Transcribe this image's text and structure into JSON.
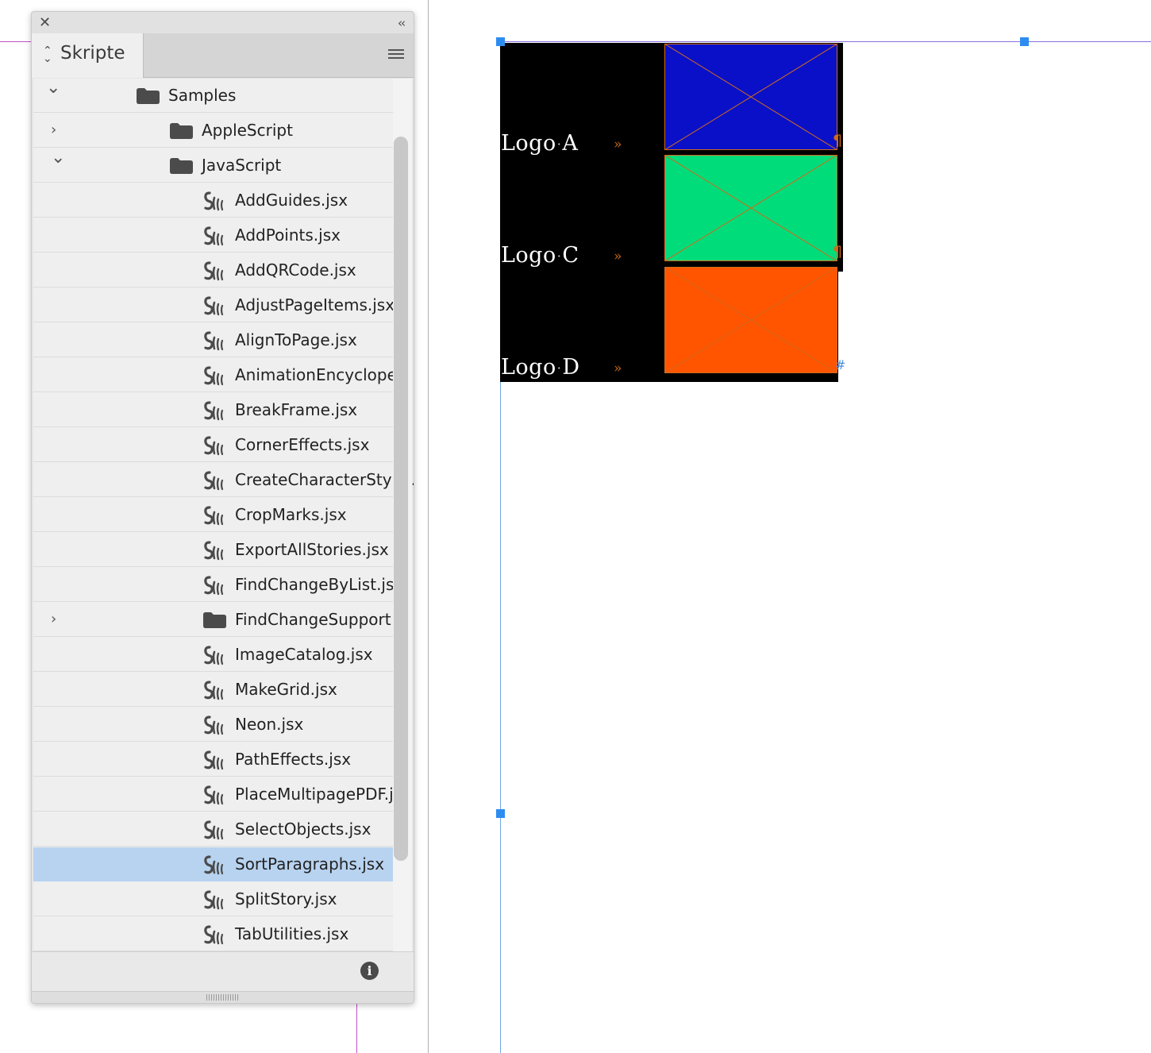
{
  "panel": {
    "title": "Skripte",
    "close_glyph": "✕",
    "collapse_glyph": "‹‹",
    "tree": [
      {
        "label": "Samples",
        "type": "folder",
        "level": 0,
        "expanded": true
      },
      {
        "label": "AppleScript",
        "type": "folder",
        "level": 1,
        "expanded": false
      },
      {
        "label": "JavaScript",
        "type": "folder",
        "level": 1,
        "expanded": true
      },
      {
        "label": "AddGuides.jsx",
        "type": "script",
        "level": 2
      },
      {
        "label": "AddPoints.jsx",
        "type": "script",
        "level": 2
      },
      {
        "label": "AddQRCode.jsx",
        "type": "script",
        "level": 2
      },
      {
        "label": "AdjustPageItems.jsx",
        "type": "script",
        "level": 2
      },
      {
        "label": "AlignToPage.jsx",
        "type": "script",
        "level": 2
      },
      {
        "label": "AnimationEncycloped...",
        "type": "script",
        "level": 2
      },
      {
        "label": "BreakFrame.jsx",
        "type": "script",
        "level": 2
      },
      {
        "label": "CornerEffects.jsx",
        "type": "script",
        "level": 2
      },
      {
        "label": "CreateCharacterStyle....",
        "type": "script",
        "level": 2
      },
      {
        "label": "CropMarks.jsx",
        "type": "script",
        "level": 2
      },
      {
        "label": "ExportAllStories.jsx",
        "type": "script",
        "level": 2
      },
      {
        "label": "FindChangeByList.jsx",
        "type": "script",
        "level": 2
      },
      {
        "label": "FindChangeSupport",
        "type": "folder",
        "level": 2,
        "expanded": false
      },
      {
        "label": "ImageCatalog.jsx",
        "type": "script",
        "level": 2
      },
      {
        "label": "MakeGrid.jsx",
        "type": "script",
        "level": 2
      },
      {
        "label": "Neon.jsx",
        "type": "script",
        "level": 2
      },
      {
        "label": "PathEffects.jsx",
        "type": "script",
        "level": 2
      },
      {
        "label": "PlaceMultipagePDF.jsx",
        "type": "script",
        "level": 2
      },
      {
        "label": "SelectObjects.jsx",
        "type": "script",
        "level": 2
      },
      {
        "label": "SortParagraphs.jsx",
        "type": "script",
        "level": 2,
        "selected": true
      },
      {
        "label": "SplitStory.jsx",
        "type": "script",
        "level": 2
      },
      {
        "label": "TabUtilities.jsx",
        "type": "script",
        "level": 2
      }
    ],
    "info_glyph": "i"
  },
  "document": {
    "logos": [
      {
        "word": "Logo",
        "letter": "A",
        "fill": "#0a10c8"
      },
      {
        "word": "Logo",
        "letter": "C",
        "fill": "#00dc7a"
      },
      {
        "word": "Logo",
        "letter": "D",
        "fill": "#ff5500"
      }
    ],
    "dot_glyph": "·",
    "tab_glyph": "»",
    "para_glyph": "¶",
    "end_glyph": "#",
    "colors": {
      "selection": "#2d8cf0",
      "frame_edge": "#d26a1c",
      "text_frame_bg": "#000000"
    }
  }
}
